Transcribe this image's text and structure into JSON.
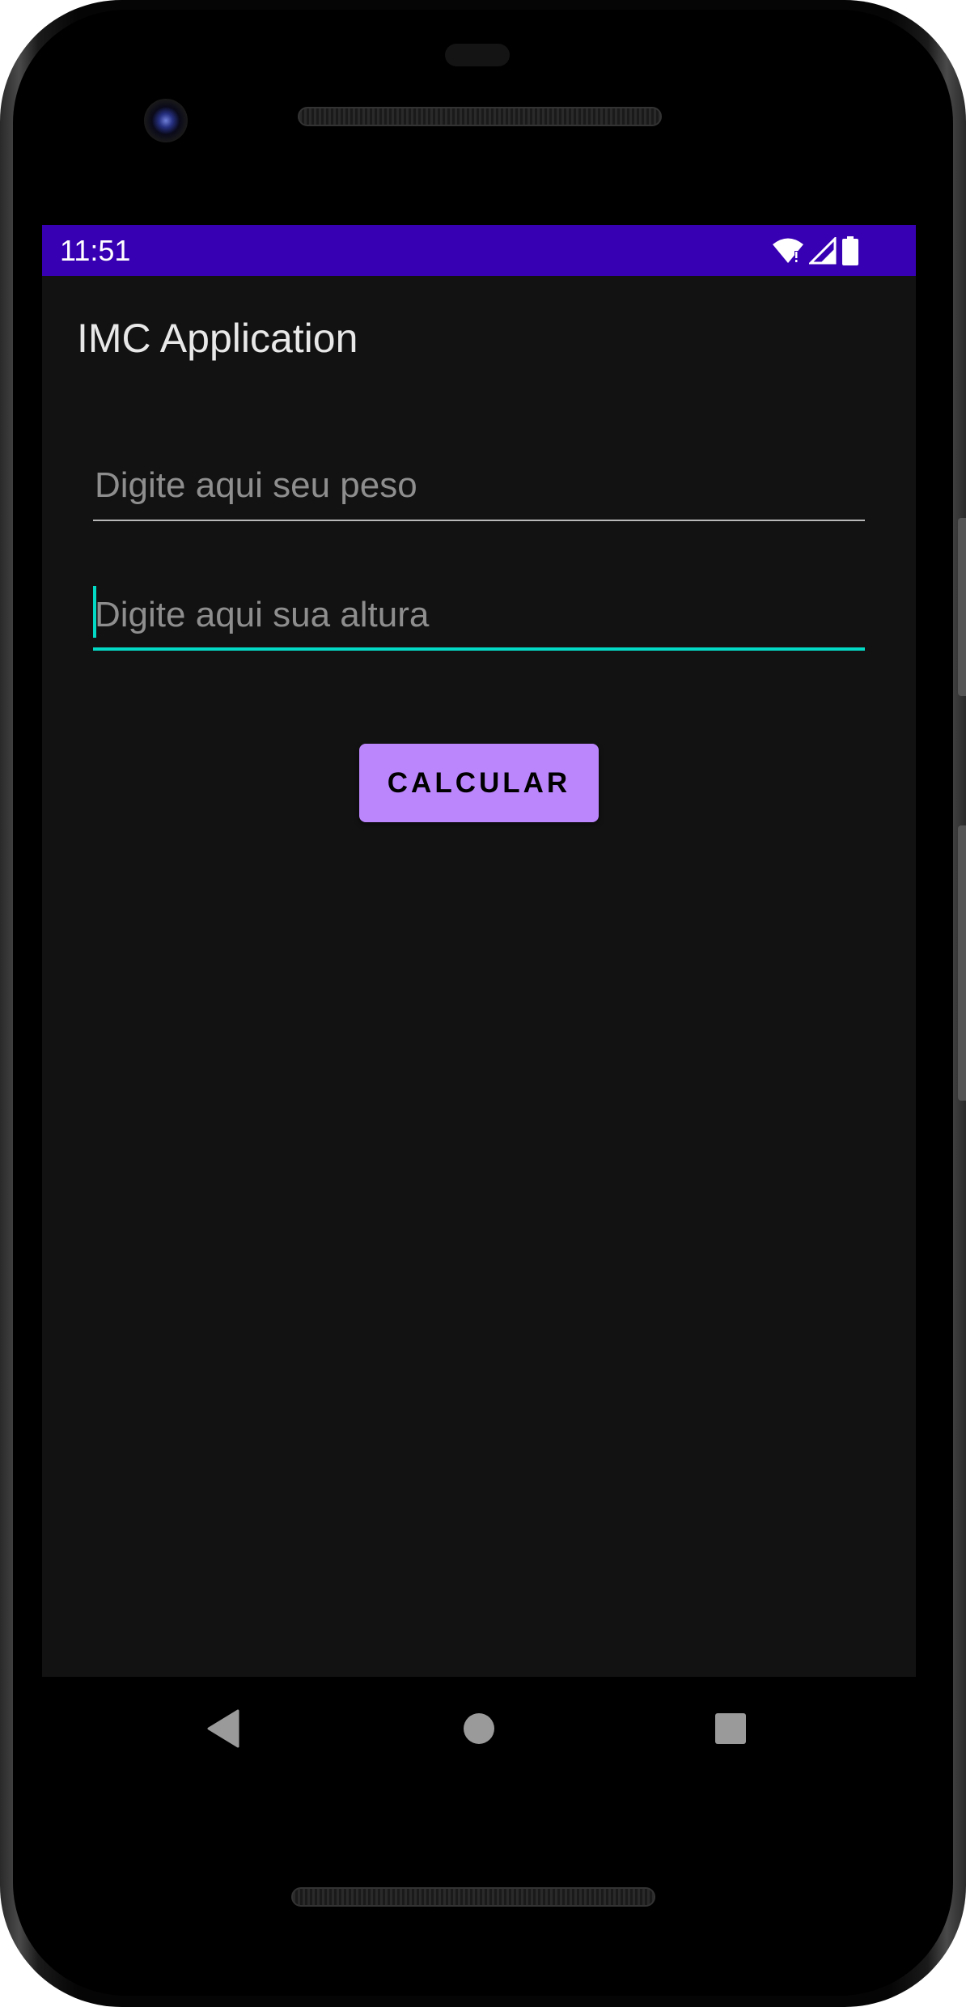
{
  "status_bar": {
    "time": "11:51",
    "background": "#3700b3",
    "icons": [
      "wifi-icon",
      "cell-signal-icon",
      "battery-icon"
    ]
  },
  "app": {
    "title": "IMC Application",
    "background": "#121212"
  },
  "form": {
    "weight_field": {
      "placeholder": "Digite aqui seu peso",
      "value": ""
    },
    "height_field": {
      "placeholder": "Digite aqui sua altura",
      "value": "",
      "focused": true
    },
    "accent_color": "#03dac5"
  },
  "calculate_button": {
    "label": "CALCULAR",
    "color": "#bb86fc"
  },
  "navigation": {
    "buttons": [
      "back-icon",
      "home-icon",
      "recents-icon"
    ]
  }
}
